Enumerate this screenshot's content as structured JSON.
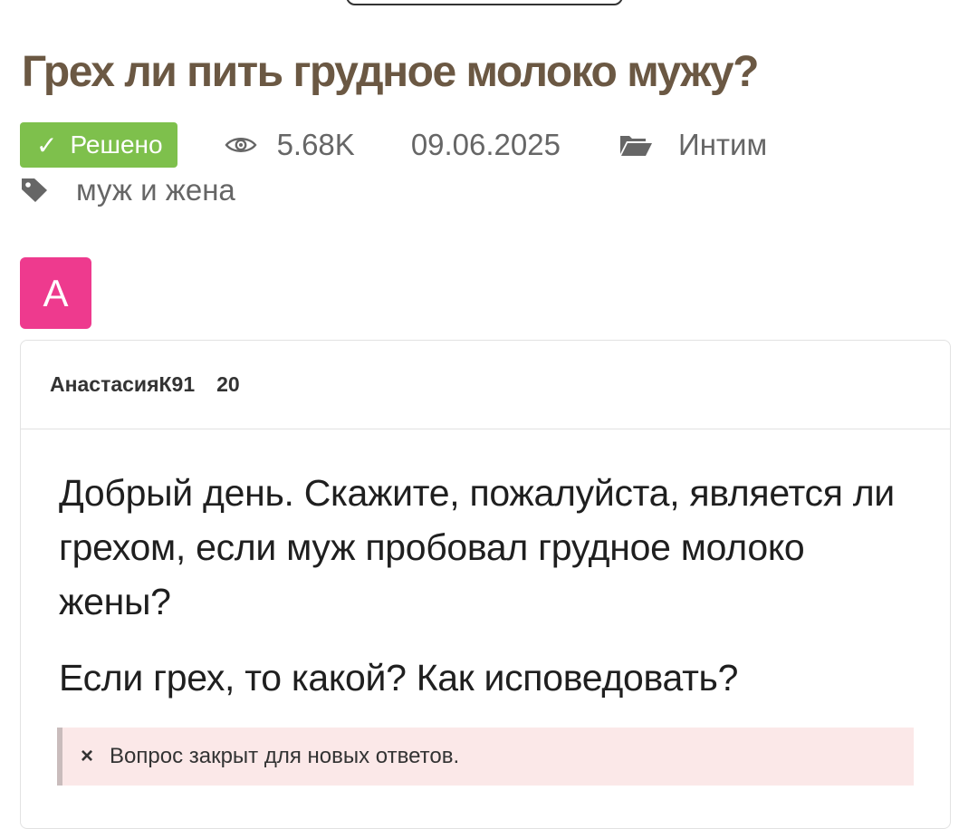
{
  "question": {
    "title": "Грех ли пить грудное молоко мужу?",
    "status_badge": {
      "check": "✓",
      "label": "Решено",
      "color": "#7ec04c"
    },
    "views": "5.68K",
    "date": "09.06.2025",
    "category": "Интим",
    "tag": "муж и жена",
    "title_color": "#6b5843"
  },
  "author": {
    "avatar_letter": "А",
    "avatar_color": "#ee3a8e",
    "name": "АнастасияК91",
    "score": "20"
  },
  "post": {
    "paragraphs": [
      "Добрый день. Скажите, пожалуйста, является ли грехом, если муж пробовал грудное молоко жены?",
      "Если грех, то какой? Как исповедовать?"
    ]
  },
  "closed_notice": {
    "icon": "×",
    "text": "Вопрос закрыт для новых ответов."
  },
  "icons": {
    "views": "eye-icon",
    "category": "folder-icon",
    "tag": "tag-icon"
  }
}
